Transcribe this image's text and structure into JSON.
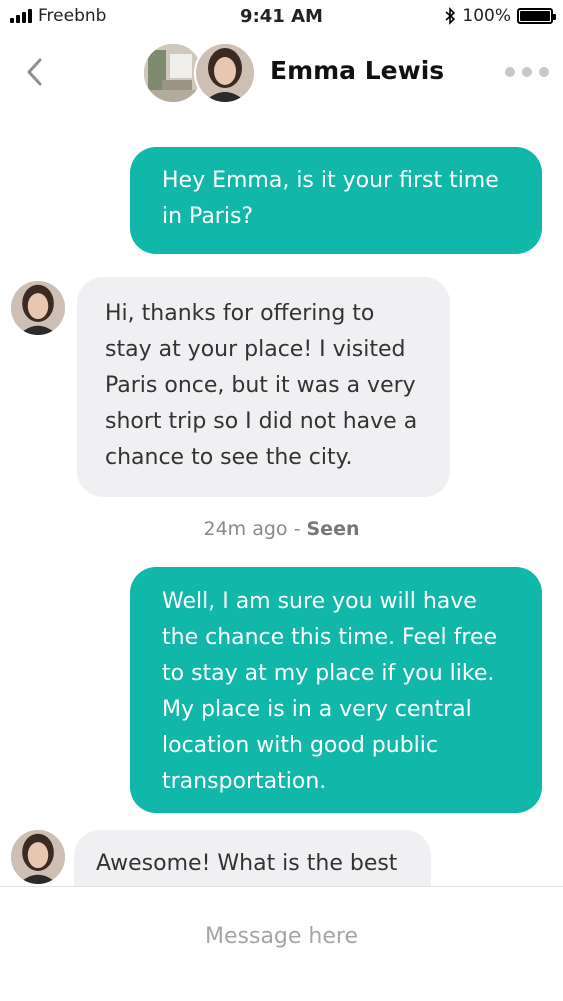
{
  "status_bar": {
    "carrier": "Freebnb",
    "time": "9:41 AM",
    "battery": "100%",
    "bluetooth_icon": "bluetooth-icon",
    "signal_icon": "signal-icon",
    "battery_icon": "battery-icon"
  },
  "header": {
    "contact_name": "Emma Lewis",
    "back_icon": "chevron-left-icon",
    "more_icon": "more-dots-icon"
  },
  "messages": [
    {
      "direction": "outgoing",
      "text": "Hey Emma, is it your first time\nin Paris?"
    },
    {
      "direction": "incoming",
      "text": "Hi, thanks for offering to\nstay at your place! I visited\nParis once, but it was a very\nshort trip so I did not have a\nchance to see the city."
    },
    {
      "direction": "outgoing",
      "text": "Well, I am sure you will have\nthe chance this time. Feel free\nto stay at my place if you like.\nMy place is in a very central\nlocation with good public\ntransportation."
    },
    {
      "direction": "incoming",
      "text": "Awesome! What is the best"
    }
  ],
  "meta": {
    "time_ago": "24m ago",
    "separator": " - ",
    "status": "Seen"
  },
  "composer": {
    "placeholder": "Message here"
  },
  "colors": {
    "outgoing_bubble": "#11b8a9",
    "incoming_bubble": "#f0eff2",
    "accent_text": "#ffffff"
  }
}
